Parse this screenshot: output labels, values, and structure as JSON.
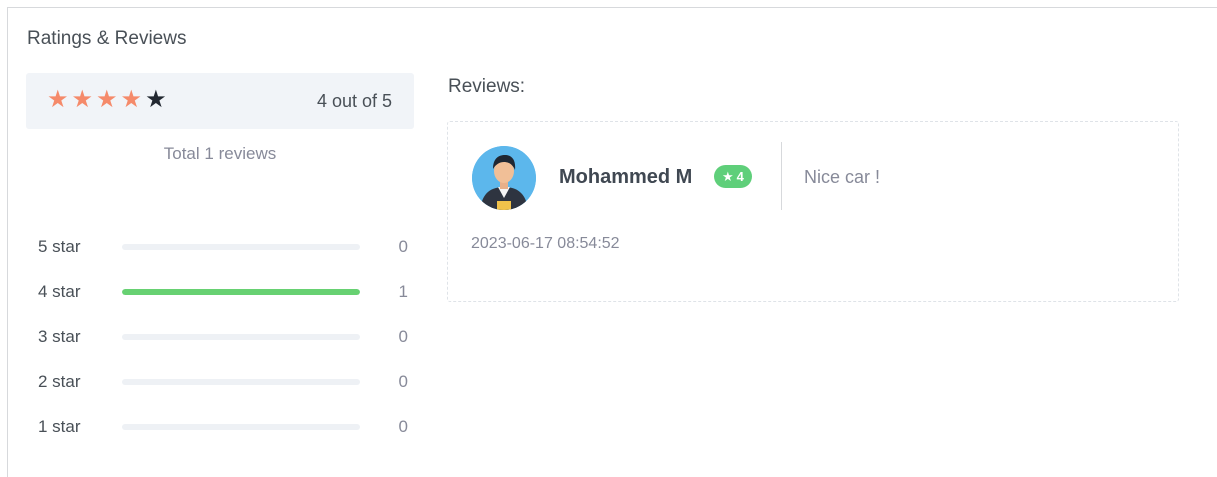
{
  "card": {
    "title": "Ratings & Reviews"
  },
  "summary": {
    "rating": 4,
    "max": 5,
    "text": "4 out of 5",
    "total_prefix": "Total",
    "total_count": "1",
    "total_suffix": "reviews"
  },
  "colors": {
    "star_filled": "#f58a6a",
    "star_empty": "#222831",
    "bar_fill": "#67d172",
    "badge": "#5fcf7a"
  },
  "breakdown": [
    {
      "label": "5 star",
      "count": "0",
      "fraction": 0
    },
    {
      "label": "4 star",
      "count": "1",
      "fraction": 1
    },
    {
      "label": "3 star",
      "count": "0",
      "fraction": 0
    },
    {
      "label": "2 star",
      "count": "0",
      "fraction": 0
    },
    {
      "label": "1 star",
      "count": "0",
      "fraction": 0
    }
  ],
  "reviews": {
    "title": "Reviews:",
    "items": [
      {
        "name": "Mohammed M",
        "rating": "4",
        "text": "Nice car !",
        "date": "2023-06-17 08:54:52",
        "avatar_icon": "user-avatar-icon"
      }
    ]
  }
}
